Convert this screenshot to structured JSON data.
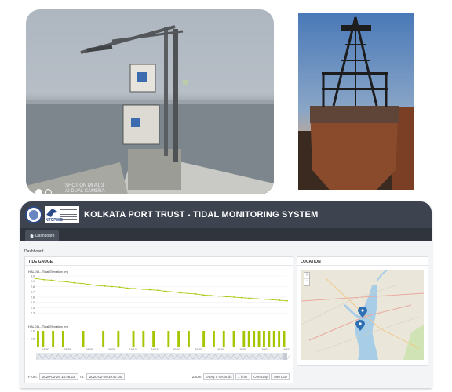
{
  "photo_left": {
    "caption_line1": "SHOT ON MI A1 3",
    "caption_line2": "AI DUAL CAMERA"
  },
  "app": {
    "title": "KOLKATA PORT TRUST - TIDAL MONITORING SYSTEM",
    "logo_text": "NTCPWC"
  },
  "nav": {
    "tab_dashboard": "Dashboard"
  },
  "breadcrumb": "Dashboard",
  "tide_panel": {
    "title": "TIDE GAUGE",
    "chart1_title": "HALDIA - Tidal Elevation (m)",
    "chart2_title": "HALDIA - Tidal Elevation (m)",
    "from_label": "From:",
    "from_value": "2020-02-29 18:46:22",
    "to_label": "To:",
    "to_value": "2020-02-29 19:47:00",
    "zoom_label": "Zoom:",
    "zoom_options": [
      "Every 5 seconds",
      "1 hour",
      "One Day",
      "Two Day"
    ]
  },
  "location_panel": {
    "title": "LOCATION",
    "zoom_in": "+",
    "zoom_out": "−"
  },
  "chart_data": {
    "type": "line",
    "title": "HALDIA - Tidal Elevation (m)",
    "ylim": [
      2.2,
      3.0
    ],
    "yticks": [
      "3.0",
      "2.9",
      "2.8",
      "2.7",
      "2.6",
      "2.5",
      "2.4",
      "2.3"
    ],
    "xticks": [
      "18:50",
      "18:55",
      "19:00",
      "19:05",
      "19:10",
      "19:15",
      "19:20",
      "19:25",
      "19:30",
      "19:35",
      "19:40",
      "19:45"
    ],
    "series": [
      {
        "values": [
          2.95,
          2.93,
          2.92,
          2.9,
          2.89,
          2.87,
          2.86,
          2.84,
          2.82,
          2.81,
          2.8,
          2.79,
          2.77,
          2.76,
          2.75,
          2.74,
          2.73,
          2.71,
          2.7,
          2.68,
          2.67,
          2.66,
          2.64,
          2.63,
          2.62,
          2.61,
          2.6,
          2.59,
          2.58,
          2.57,
          2.56,
          2.55,
          2.54,
          2.53
        ]
      }
    ],
    "bars": {
      "yticks": [
        "1.0",
        "0.5"
      ],
      "values": [
        1,
        1,
        0,
        1,
        0,
        1,
        0,
        0,
        0,
        1,
        0,
        0,
        0,
        1,
        0,
        0,
        1,
        0,
        0,
        1,
        0,
        1,
        0,
        1,
        0,
        0,
        1,
        0,
        1,
        0,
        1,
        0,
        0,
        1,
        0,
        1,
        0,
        1,
        0,
        1,
        0,
        1,
        1,
        1,
        1,
        1,
        1,
        1,
        1,
        1
      ]
    },
    "accent": "#a5c500"
  }
}
